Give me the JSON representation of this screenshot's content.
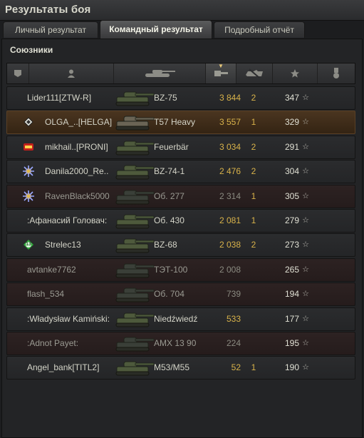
{
  "window": {
    "title": "Результаты боя"
  },
  "tabs": [
    {
      "label": "Личный результат",
      "active": false
    },
    {
      "label": "Командный результат",
      "active": true
    },
    {
      "label": "Подробный отчёт",
      "active": false
    }
  ],
  "team": {
    "title": "Союзники"
  },
  "columns": [
    {
      "icon": "platoon-icon"
    },
    {
      "icon": "player-icon"
    },
    {
      "icon": "tank-icon"
    },
    {
      "icon": "damage-icon",
      "sorted": true
    },
    {
      "icon": "kills-icon"
    },
    {
      "icon": "experience-star-icon"
    },
    {
      "icon": "medal-icon"
    }
  ],
  "rows": [
    {
      "player": "Lider111[ZTW-R]",
      "badge": null,
      "tank": "BZ-75",
      "damage": "3 844",
      "kills": "2",
      "xp": "347",
      "state": "alive"
    },
    {
      "player": "OLGA_..[HELGA]",
      "badge": "diamond-clan-icon",
      "tank": "T57 Heavy",
      "damage": "3 557",
      "kills": "1",
      "xp": "329",
      "state": "highlight"
    },
    {
      "player": "mikhail..[PRONI]",
      "badge": "red-clan-icon",
      "tank": "Feuerbär",
      "damage": "3 034",
      "kills": "2",
      "xp": "291",
      "state": "alive"
    },
    {
      "player": "Danila2000_Re..",
      "badge": "snowflake-clan-icon",
      "tank": "BZ-74-1",
      "damage": "2 476",
      "kills": "2",
      "xp": "304",
      "state": "alive"
    },
    {
      "player": "RavenBlack5000",
      "badge": "snowflake-clan-icon",
      "tank": "Об. 277",
      "damage": "2 314",
      "kills": "1",
      "xp": "305",
      "state": "dead"
    },
    {
      "player": ":Афанасий Головач:",
      "badge": null,
      "tank": "Об. 430",
      "damage": "2 081",
      "kills": "1",
      "xp": "279",
      "state": "alive"
    },
    {
      "player": "Strelec13",
      "badge": "green-clan-icon",
      "badge_text": "13",
      "tank": "BZ-68",
      "damage": "2 038",
      "kills": "2",
      "xp": "273",
      "state": "alive"
    },
    {
      "player": "avtanke7762",
      "badge": null,
      "tank": "ТЭТ-100",
      "damage": "2 008",
      "kills": "",
      "xp": "265",
      "state": "dead"
    },
    {
      "player": "flash_534",
      "badge": null,
      "tank": "Об. 704",
      "damage": "739",
      "kills": "",
      "xp": "194",
      "state": "dead"
    },
    {
      "player": ":Władysław Kamiński:",
      "badge": null,
      "tank": "Niedźwiedź",
      "damage": "533",
      "kills": "",
      "xp": "177",
      "state": "alive"
    },
    {
      "player": ":Adnot Payet:",
      "badge": null,
      "tank": "AMX 13 90",
      "damage": "224",
      "kills": "",
      "xp": "195",
      "state": "dead"
    },
    {
      "player": "Angel_bank[TITL2]",
      "badge": null,
      "tank": "M53/M55",
      "damage": "52",
      "kills": "1",
      "xp": "190",
      "state": "alive"
    }
  ],
  "star_glyph": "☆"
}
